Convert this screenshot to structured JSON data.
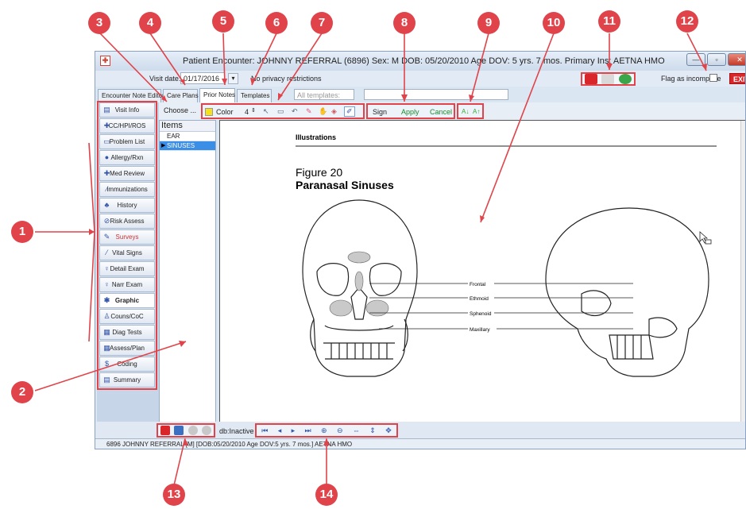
{
  "window": {
    "title": "Patient Encounter:  JOHNNY REFERRAL (6896)  Sex: M  DOB: 05/20/2010  Age DOV: 5 yrs. 7 mos.  Primary Ins: AETNA HMO",
    "min": "—",
    "max": "▫",
    "close": "✕"
  },
  "visit": {
    "label": "Visit date:",
    "value": "01/17/2016",
    "privacy": "No privacy restrictions"
  },
  "flag": {
    "label": "Flag as incomplete",
    "exit": "EXIT"
  },
  "tabs": [
    "Encounter Note Editor",
    "Care Plans",
    "Prior Notes",
    "Templates"
  ],
  "templates": {
    "placeholder": "All templates:"
  },
  "toolbar": {
    "choose": "Choose ...",
    "color": "Color",
    "size": "4",
    "sign": "Sign",
    "apply": "Apply",
    "cancel": "Cancel"
  },
  "sidebar": {
    "items": [
      {
        "label": "Visit Info",
        "icon": "visit-info-icon",
        "glyph": "▤"
      },
      {
        "label": "CC/HPI/ROS",
        "icon": "cc-hpi-icon",
        "glyph": "✚"
      },
      {
        "label": "Problem List",
        "icon": "problem-list-icon",
        "glyph": "▭"
      },
      {
        "label": "Allergy/Rxn",
        "icon": "allergy-icon",
        "glyph": "●"
      },
      {
        "label": "Med Review",
        "icon": "med-review-icon",
        "glyph": "✚"
      },
      {
        "label": "Immunizations",
        "icon": "immunizations-icon",
        "glyph": "⁄"
      },
      {
        "label": "History",
        "icon": "history-icon",
        "glyph": "♣"
      },
      {
        "label": "Risk Assess",
        "icon": "risk-assess-icon",
        "glyph": "⊘"
      },
      {
        "label": "Surveys",
        "icon": "surveys-icon",
        "glyph": "✎"
      },
      {
        "label": "Vital Signs",
        "icon": "vital-signs-icon",
        "glyph": "⁄"
      },
      {
        "label": "Detail Exam",
        "icon": "detail-exam-icon",
        "glyph": "♀"
      },
      {
        "label": "Narr Exam",
        "icon": "narr-exam-icon",
        "glyph": "♀"
      },
      {
        "label": "Graphic",
        "icon": "graphic-icon",
        "glyph": "✱"
      },
      {
        "label": "Couns/CoC",
        "icon": "couns-icon",
        "glyph": "♙"
      },
      {
        "label": "Diag Tests",
        "icon": "diag-tests-icon",
        "glyph": "▦"
      },
      {
        "label": "Assess/Plan",
        "icon": "assess-plan-icon",
        "glyph": "▦"
      },
      {
        "label": "Coding",
        "icon": "coding-icon",
        "glyph": "$"
      },
      {
        "label": "Summary",
        "icon": "summary-icon",
        "glyph": "▤"
      }
    ],
    "selected": 12
  },
  "items_pane": {
    "header": "Items",
    "rows": [
      "EAR",
      "SINUSES"
    ],
    "selected": 1
  },
  "document": {
    "section": "Illustrations",
    "figure": "Figure 20",
    "heading": "Paranasal Sinuses",
    "labels": [
      "Frontal",
      "Ethmoid",
      "Sphenoid",
      "Maxillary"
    ]
  },
  "bottom": {
    "db_status": "db:Inactive"
  },
  "status": {
    "text": "6896 JOHNNY REFERRAL [M] [DOB:05/20/2010  Age DOV:5 yrs. 7 mos.] AETNA HMO"
  },
  "callouts": [
    "1",
    "2",
    "3",
    "4",
    "5",
    "6",
    "7",
    "8",
    "9",
    "10",
    "11",
    "12",
    "13",
    "14"
  ],
  "colors": {
    "callout": "#e0444a",
    "selection": "#3a8ee6",
    "exit": "#d9262b"
  }
}
